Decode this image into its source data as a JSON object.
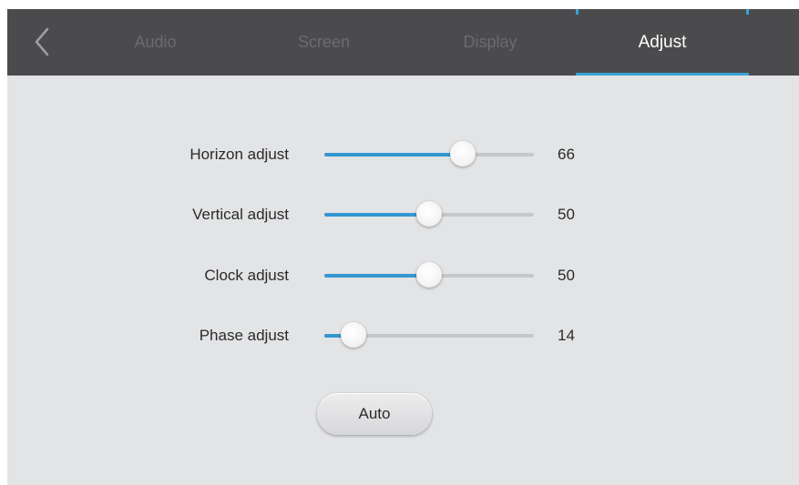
{
  "header": {
    "tabs": [
      {
        "label": "Audio",
        "active": false
      },
      {
        "label": "Screen",
        "active": false
      },
      {
        "label": "Display",
        "active": false
      },
      {
        "label": "Adjust",
        "active": true
      }
    ],
    "accent_color": "#3aa3d9"
  },
  "adjust": {
    "rows": [
      {
        "label": "Horizon adjust",
        "value": "66",
        "level": 66
      },
      {
        "label": "Vertical adjust",
        "value": "50",
        "level": 50
      },
      {
        "label": "Clock adjust",
        "value": "50",
        "level": 50
      },
      {
        "label": "Phase adjust",
        "value": "14",
        "level": 14
      }
    ],
    "auto_label": "Auto"
  },
  "icons": {
    "back": "chevron-left-icon"
  },
  "colors": {
    "slider_fill": "#3397d1",
    "topbar": "#4b4b4d",
    "panel": "#e3e4e6"
  }
}
